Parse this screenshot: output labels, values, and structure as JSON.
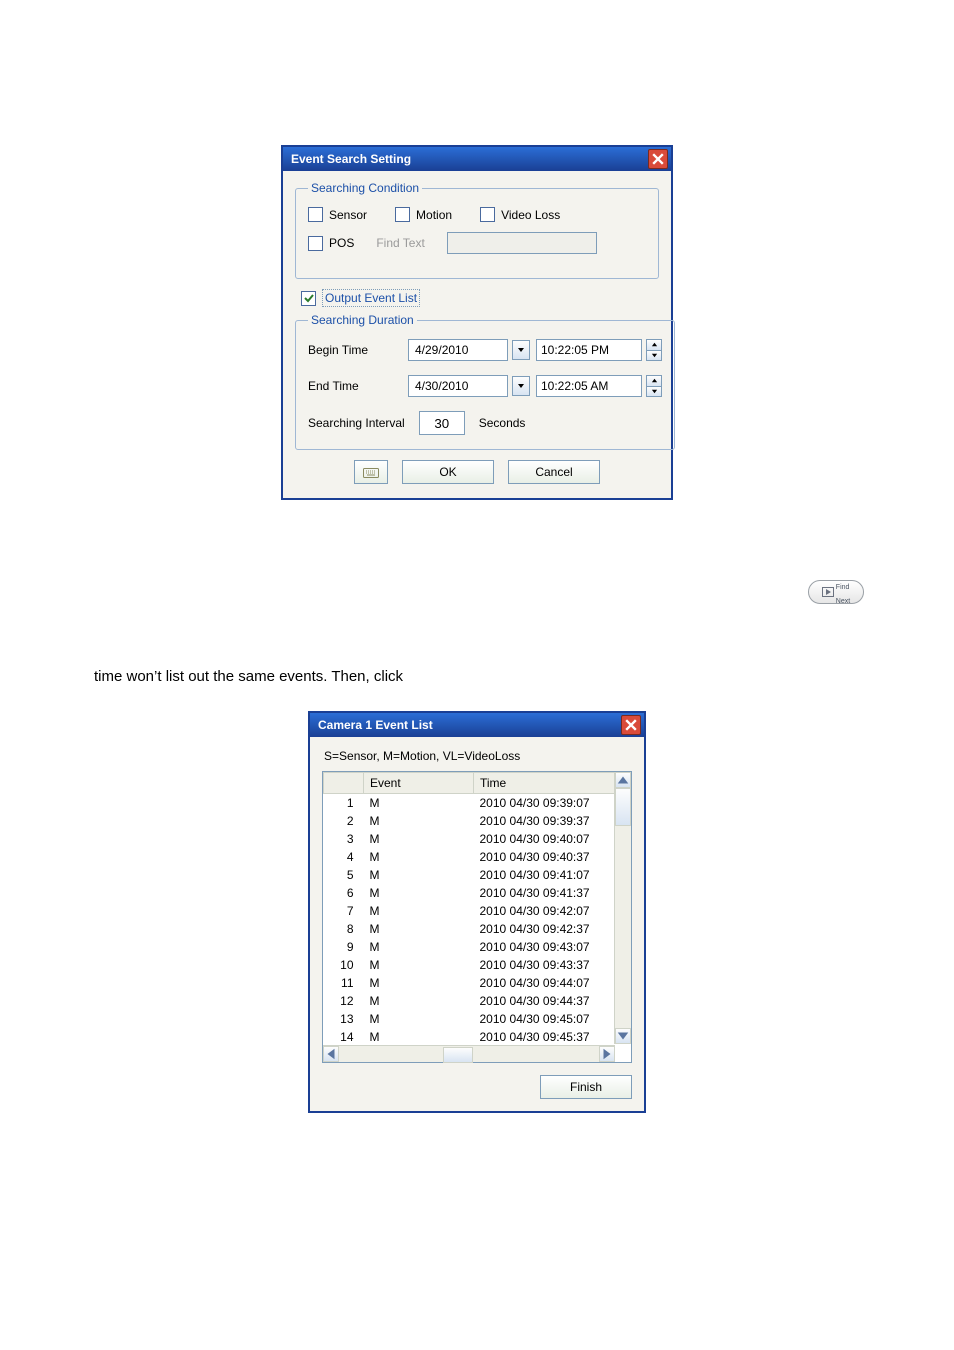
{
  "dialog1": {
    "title": "Event Search Setting",
    "condition": {
      "legend": "Searching Condition",
      "sensor": "Sensor",
      "motion": "Motion",
      "videoloss": "Video Loss",
      "pos": "POS",
      "findtext_label": "Find Text",
      "findtext_value": ""
    },
    "output_event_list": "Output Event List",
    "duration": {
      "legend": "Searching Duration",
      "begin_label": "Begin Time",
      "begin_date": "4/29/2010",
      "begin_time": "10:22:05 PM",
      "end_label": "End Time",
      "end_date": "4/30/2010",
      "end_time": "10:22:05 AM",
      "interval_label": "Searching Interval",
      "interval_value": "30",
      "interval_unit": "Seconds"
    },
    "buttons": {
      "ok": "OK",
      "cancel": "Cancel"
    }
  },
  "findnext": {
    "line1": "Find",
    "line2": "Next"
  },
  "paragraph": "time won’t list out the same events. Then, click",
  "dialog2": {
    "title": "Camera 1  Event List",
    "legend_line": "S=Sensor, M=Motion, VL=VideoLoss",
    "headers": {
      "event": "Event",
      "time": "Time"
    },
    "rows": [
      {
        "n": "1",
        "e": "M",
        "t": "2010 04/30 09:39:07"
      },
      {
        "n": "2",
        "e": "M",
        "t": "2010 04/30 09:39:37"
      },
      {
        "n": "3",
        "e": "M",
        "t": "2010 04/30 09:40:07"
      },
      {
        "n": "4",
        "e": "M",
        "t": "2010 04/30 09:40:37"
      },
      {
        "n": "5",
        "e": "M",
        "t": "2010 04/30 09:41:07"
      },
      {
        "n": "6",
        "e": "M",
        "t": "2010 04/30 09:41:37"
      },
      {
        "n": "7",
        "e": "M",
        "t": "2010 04/30 09:42:07"
      },
      {
        "n": "8",
        "e": "M",
        "t": "2010 04/30 09:42:37"
      },
      {
        "n": "9",
        "e": "M",
        "t": "2010 04/30 09:43:07"
      },
      {
        "n": "10",
        "e": "M",
        "t": "2010 04/30 09:43:37"
      },
      {
        "n": "11",
        "e": "M",
        "t": "2010 04/30 09:44:07"
      },
      {
        "n": "12",
        "e": "M",
        "t": "2010 04/30 09:44:37"
      },
      {
        "n": "13",
        "e": "M",
        "t": "2010 04/30 09:45:07"
      },
      {
        "n": "14",
        "e": "M",
        "t": "2010 04/30 09:45:37"
      }
    ],
    "finish": "Finish"
  }
}
